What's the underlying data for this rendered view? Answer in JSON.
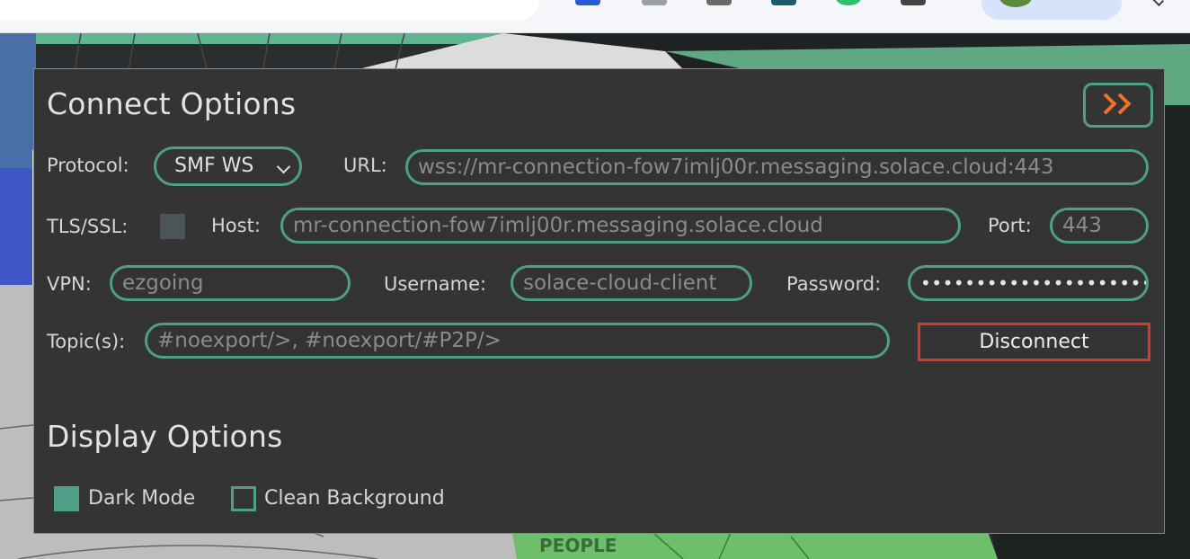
{
  "connect": {
    "heading": "Connect Options",
    "protocol_label": "Protocol:",
    "protocol_value": "SMF WS",
    "url_label": "URL:",
    "url_value": "wss://mr-connection-fow7imlj00r.messaging.solace.cloud:443",
    "tls_label": "TLS/SSL:",
    "tls_checked": false,
    "host_label": "Host:",
    "host_value": "mr-connection-fow7imlj00r.messaging.solace.cloud",
    "port_label": "Port:",
    "port_value": "443",
    "vpn_label": "VPN:",
    "vpn_value": "ezgoing",
    "username_label": "Username:",
    "username_value": "solace-cloud-client",
    "password_label": "Password:",
    "password_masked": "••••••••••••••••••••••••",
    "topics_label": "Topic(s):",
    "topics_value": "#noexport/>, #noexport/#P2P/>",
    "disconnect_label": "Disconnect",
    "collapse_icon": "double-chevron-right-icon"
  },
  "display": {
    "heading": "Display Options",
    "dark_mode_label": "Dark Mode",
    "dark_mode_checked": true,
    "clean_bg_label": "Clean Background",
    "clean_bg_checked": false
  },
  "map": {
    "region_label": "PEOPLE"
  },
  "colors": {
    "accent": "#4e9e88",
    "disconnect_border": "#d8382e",
    "collapse_arrow": "#e8742e",
    "panel_bg": "#343434"
  }
}
